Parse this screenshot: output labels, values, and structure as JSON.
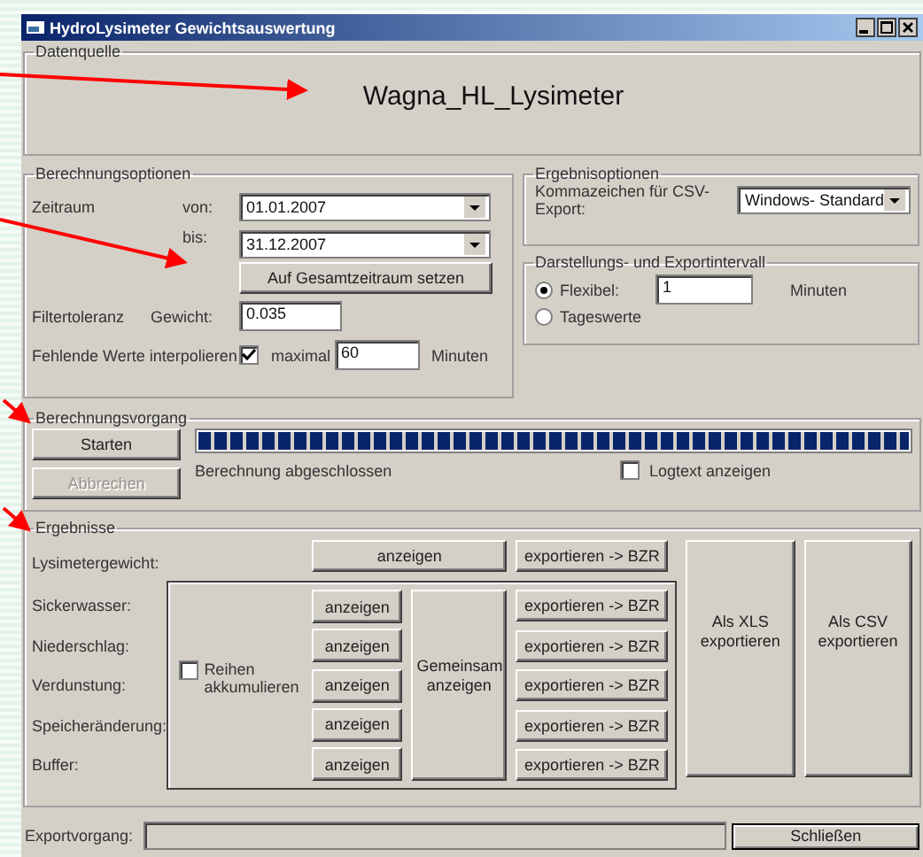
{
  "window": {
    "title": "HydroLysimeter Gewichtsauswertung"
  },
  "data_source": {
    "legend": "Datenquelle",
    "name": "Wagna_HL_Lysimeter"
  },
  "calc_options": {
    "legend": "Berechnungsoptionen",
    "period_label": "Zeitraum",
    "from_label": "von:",
    "from_value": "01.01.2007",
    "to_label": "bis:",
    "to_value": "31.12.2007",
    "full_range_button": "Auf Gesamtzeitraum setzen",
    "filter_label": "Filtertoleranz",
    "weight_label": "Gewicht:",
    "weight_value": "0.035",
    "interpolate_label": "Fehlende Werte interpolieren",
    "interpolate_checked": true,
    "max_label": "maximal",
    "max_value": "60",
    "max_unit": "Minuten"
  },
  "result_options": {
    "legend": "Ergebnisoptionen",
    "separator_label": "Kommazeichen für CSV-Export:",
    "separator_value": "Windows- Standard"
  },
  "interval": {
    "legend": "Darstellungs- und Exportintervall",
    "options": [
      {
        "label": "Flexibel:",
        "selected": true
      },
      {
        "label": "Tageswerte",
        "selected": false
      }
    ],
    "value": "1",
    "unit": "Minuten"
  },
  "process": {
    "legend": "Berechnungsvorgang",
    "buttons": [
      {
        "label": "Starten",
        "disabled": false
      },
      {
        "label": "Abbrechen",
        "disabled": true
      }
    ],
    "level": 1,
    "status": "Berechnung abgeschlossen",
    "log_label": "Logtext anzeigen",
    "log_checked": false
  },
  "results": {
    "legend": "Ergebnisse",
    "main": {
      "label": "Lysimetergewicht:",
      "show": "anzeigen",
      "export": "exportieren -> BZR"
    },
    "series": [
      {
        "label": "Sickerwasser:",
        "show": "anzeigen",
        "export": "exportieren -> BZR"
      },
      {
        "label": "Niederschlag:",
        "show": "anzeigen",
        "export": "exportieren -> BZR"
      },
      {
        "label": "Verdunstung:",
        "show": "anzeigen",
        "export": "exportieren -> BZR"
      },
      {
        "label": "Speicheränderung:",
        "show": "anzeigen",
        "export": "exportieren -> BZR"
      },
      {
        "label": "Buffer:",
        "show": "anzeigen",
        "export": "exportieren -> BZR"
      }
    ],
    "accumulate_label": "Reihen akkumulieren",
    "accumulate_checked": false,
    "combined_button": "Gemeinsam anzeigen",
    "xls_button": "Als XLS exportieren",
    "csv_button": "Als CSV exportieren"
  },
  "export": {
    "label": "Exportvorgang:",
    "close_button": "Schließen"
  }
}
